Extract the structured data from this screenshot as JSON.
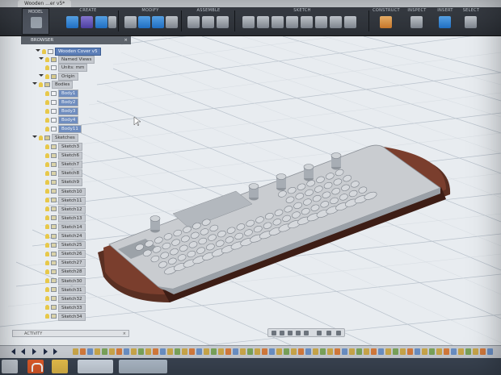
{
  "window": {
    "tab_title": "Wooden ...er v5*"
  },
  "toolbar": {
    "workspace_label": "MODEL",
    "groups": [
      {
        "label": "CREATE"
      },
      {
        "label": "MODIFY"
      },
      {
        "label": "ASSEMBLE"
      },
      {
        "label": "SKETCH"
      },
      {
        "label": "CONSTRUCT"
      },
      {
        "label": "INSPECT"
      },
      {
        "label": "INSERT"
      },
      {
        "label": "SELECT"
      }
    ]
  },
  "browser": {
    "title": "BROWSER",
    "nodes": [
      {
        "label": "Wooden Cover v5",
        "selected": true
      },
      {
        "label": "Named Views"
      },
      {
        "label": "Units: mm"
      },
      {
        "label": "Origin"
      },
      {
        "label": "Bodies"
      },
      {
        "label": "Body1"
      },
      {
        "label": "Body2"
      },
      {
        "label": "Body3"
      },
      {
        "label": "Body4"
      },
      {
        "label": "Body11"
      },
      {
        "label": "Sketches"
      },
      {
        "label": "Sketch3"
      },
      {
        "label": "Sketch6"
      },
      {
        "label": "Sketch7"
      },
      {
        "label": "Sketch8"
      },
      {
        "label": "Sketch9"
      },
      {
        "label": "Sketch10"
      },
      {
        "label": "Sketch11"
      },
      {
        "label": "Sketch12"
      },
      {
        "label": "Sketch13"
      },
      {
        "label": "Sketch14"
      },
      {
        "label": "Sketch24"
      },
      {
        "label": "Sketch25"
      },
      {
        "label": "Sketch26"
      },
      {
        "label": "Sketch27"
      },
      {
        "label": "Sketch28"
      },
      {
        "label": "Sketch30"
      },
      {
        "label": "Sketch31"
      },
      {
        "label": "Sketch32"
      },
      {
        "label": "Sketch33"
      },
      {
        "label": "Sketch34"
      }
    ]
  },
  "activity": {
    "label": "ACTIVITY"
  },
  "colors": {
    "toolbar_bg": "#2f343b",
    "canvas_bg": "#e8ecf0",
    "grid": "#b9c2cc",
    "wood": "#5a2f22",
    "plate": "#c9ccd0",
    "selection": "#5d7fb8"
  }
}
